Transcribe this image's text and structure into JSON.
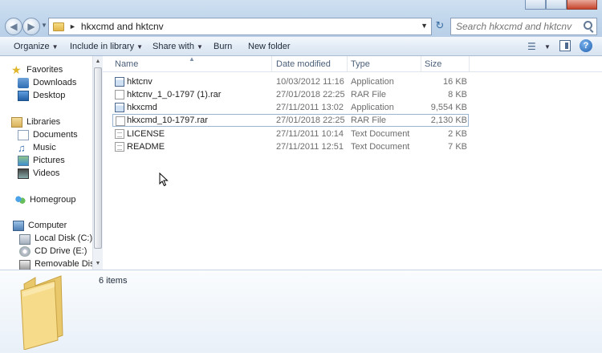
{
  "window": {
    "breadcrumb": "hkxcmd and hktcnv",
    "search_placeholder": "Search hkxcmd and hktcnv"
  },
  "toolbar": {
    "organize": "Organize",
    "include_in_library": "Include in library",
    "share_with": "Share with",
    "burn": "Burn",
    "new_folder": "New folder"
  },
  "nav": {
    "favorites": "Favorites",
    "downloads": "Downloads",
    "desktop": "Desktop",
    "libraries": "Libraries",
    "documents": "Documents",
    "music": "Music",
    "pictures": "Pictures",
    "videos": "Videos",
    "homegroup": "Homegroup",
    "computer": "Computer",
    "local_disk": "Local Disk (C:)",
    "cd_drive": "CD Drive (E:)",
    "removable_disk": "Removable Disk ("
  },
  "columns": {
    "name": "Name",
    "date_modified": "Date modified",
    "type": "Type",
    "size": "Size"
  },
  "files": [
    {
      "name": "hktcnv",
      "date": "10/03/2012 11:16",
      "type": "Application",
      "size": "16 KB",
      "icon": "application-icon"
    },
    {
      "name": "hktcnv_1_0-1797 (1).rar",
      "date": "27/01/2018 22:25",
      "type": "RAR File",
      "size": "8 KB",
      "icon": "rar-file-icon"
    },
    {
      "name": "hkxcmd",
      "date": "27/11/2011 13:02",
      "type": "Application",
      "size": "9,554 KB",
      "icon": "application-icon"
    },
    {
      "name": "hkxcmd_10-1797.rar",
      "date": "27/01/2018 22:25",
      "type": "RAR File",
      "size": "2,130 KB",
      "icon": "rar-file-icon"
    },
    {
      "name": "LICENSE",
      "date": "27/11/2011 10:14",
      "type": "Text Document",
      "size": "2 KB",
      "icon": "text-document-icon"
    },
    {
      "name": "README",
      "date": "27/11/2011 12:51",
      "type": "Text Document",
      "size": "7 KB",
      "icon": "text-document-icon"
    }
  ],
  "details": {
    "item_count": "6 items"
  }
}
